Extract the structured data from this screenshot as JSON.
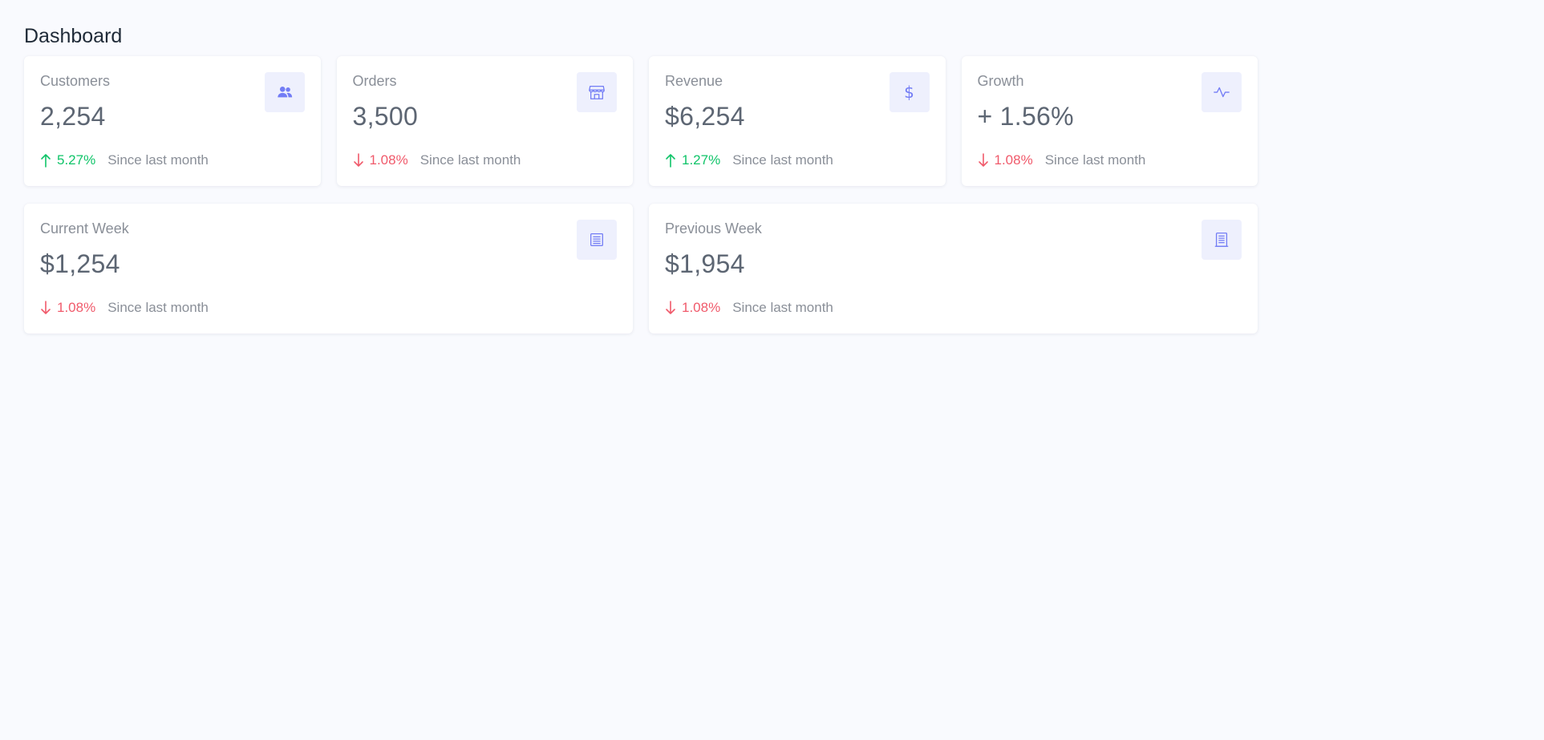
{
  "page": {
    "title": "Dashboard"
  },
  "colors": {
    "accent": "#727cf5",
    "up": "#10c469",
    "down": "#f05a6b"
  },
  "cards": [
    {
      "label": "Customers",
      "value": "2,254",
      "trend_dir": "up",
      "trend": "5.27%",
      "since": "Since last month",
      "icon": "users-icon"
    },
    {
      "label": "Orders",
      "value": "3,500",
      "trend_dir": "down",
      "trend": "1.08%",
      "since": "Since last month",
      "icon": "store-icon"
    },
    {
      "label": "Revenue",
      "value": "$6,254",
      "trend_dir": "up",
      "trend": "1.27%",
      "since": "Since last month",
      "icon": "dollar-icon",
      "icon_glyph": "$"
    },
    {
      "label": "Growth",
      "value": "+ 1.56%",
      "trend_dir": "down",
      "trend": "1.08%",
      "since": "Since last month",
      "icon": "pulse-icon"
    },
    {
      "label": "Current Week",
      "value": "$1,254",
      "trend_dir": "down",
      "trend": "1.08%",
      "since": "Since last month",
      "icon": "document-icon"
    },
    {
      "label": "Previous Week",
      "value": "$1,954",
      "trend_dir": "down",
      "trend": "1.08%",
      "since": "Since last month",
      "icon": "building-icon"
    }
  ]
}
